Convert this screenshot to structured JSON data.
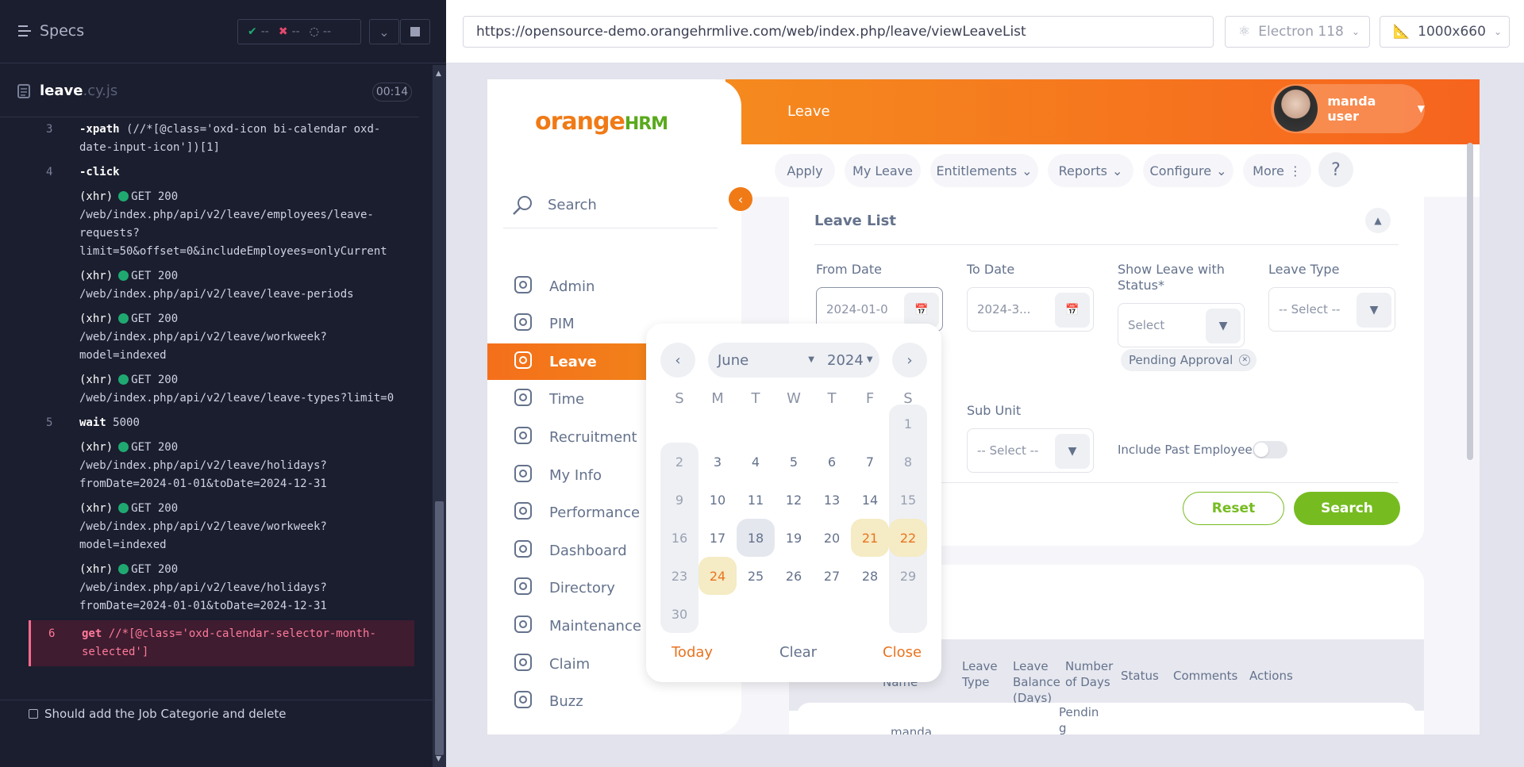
{
  "cypress": {
    "specs_label": "Specs",
    "stats": {
      "passed": "--",
      "failed": "--",
      "pending": "--"
    },
    "file": {
      "name": "leave",
      "ext": ".cy.js"
    },
    "timer": "00:14",
    "commands": [
      {
        "num": "3",
        "name": "-xpath",
        "text": "(//*[@class='oxd-icon bi-calendar oxd-date-input-icon'])[1]"
      },
      {
        "num": "4",
        "name": "-click",
        "text": ""
      },
      {
        "num": "",
        "name": "(xhr)",
        "text": "GET 200 /web/index.php/api/v2/leave/employees/leave-requests?limit=50&offset=0&includeEmployees=onlyCurrent"
      },
      {
        "num": "",
        "name": "(xhr)",
        "text": "GET 200 /web/index.php/api/v2/leave/leave-periods"
      },
      {
        "num": "",
        "name": "(xhr)",
        "text": "GET 200 /web/index.php/api/v2/leave/workweek?model=indexed"
      },
      {
        "num": "",
        "name": "(xhr)",
        "text": "GET 200 /web/index.php/api/v2/leave/leave-types?limit=0"
      },
      {
        "num": "5",
        "name": "wait",
        "text": "5000"
      },
      {
        "num": "",
        "name": "(xhr)",
        "text": "GET 200 /web/index.php/api/v2/leave/holidays?fromDate=2024-01-01&toDate=2024-12-31"
      },
      {
        "num": "",
        "name": "(xhr)",
        "text": "GET 200 /web/index.php/api/v2/leave/workweek?model=indexed"
      },
      {
        "num": "",
        "name": "(xhr)",
        "text": "GET 200 /web/index.php/api/v2/leave/holidays?fromDate=2024-01-01&toDate=2024-12-31"
      },
      {
        "num": "6",
        "name": "get",
        "text": "//*[@class='oxd-calendar-selector-month-selected']"
      }
    ],
    "test_title": "Should add the Job Categorie and delete"
  },
  "browser": {
    "url": "https://opensource-demo.orangehrmlive.com/web/index.php/leave/viewLeaveList",
    "engine": "Electron 118",
    "viewport": "1000x660"
  },
  "app": {
    "logo": {
      "orange": "orange",
      "hrm": "HRM"
    },
    "search_label": "Search",
    "nav": [
      "Admin",
      "PIM",
      "Leave",
      "Time",
      "Recruitment",
      "My Info",
      "Performance",
      "Dashboard",
      "Directory",
      "Maintenance",
      "Claim",
      "Buzz"
    ],
    "header_title": "Leave",
    "user_name": "manda user",
    "tabs": [
      "Apply",
      "My Leave",
      "Entitlements",
      "Reports",
      "Configure",
      "More"
    ],
    "help": "?",
    "leave_list": {
      "title": "Leave List",
      "from_date_label": "From Date",
      "from_date_value": "2024-01-0",
      "to_date_label": "To Date",
      "to_date_value": "2024-3...",
      "status_label": "Show Leave with Status*",
      "status_value": "Select",
      "leave_type_label": "Leave Type",
      "leave_type_value": "-- Select --",
      "chip": "Pending Approval",
      "sub_unit_label": "Sub Unit",
      "sub_unit_value": "-- Select --",
      "past_label": "Include Past Employees",
      "reset": "Reset",
      "search": "Search"
    },
    "table_headers": [
      "ee Name",
      "Leave Type",
      "Leave Balance (Days)",
      "Number of Days",
      "Status",
      "Comments",
      "Actions"
    ],
    "row": {
      "name": "manda",
      "status": "Pendin g"
    }
  },
  "calendar": {
    "month": "June",
    "year": "2024",
    "weekdays": [
      "S",
      "M",
      "T",
      "W",
      "T",
      "F",
      "S"
    ],
    "weeks": [
      [
        "",
        "",
        "",
        "",
        "",
        "",
        "1"
      ],
      [
        "2",
        "3",
        "4",
        "5",
        "6",
        "7",
        "8"
      ],
      [
        "9",
        "10",
        "11",
        "12",
        "13",
        "14",
        "15"
      ],
      [
        "16",
        "17",
        "18",
        "19",
        "20",
        "21",
        "22"
      ],
      [
        "23",
        "24",
        "25",
        "26",
        "27",
        "28",
        "29"
      ],
      [
        "30",
        "",
        "",
        "",
        "",
        "",
        ""
      ]
    ],
    "selected": "18",
    "holidays": [
      "21",
      "22",
      "24"
    ],
    "today_label": "Today",
    "clear_label": "Clear",
    "close_label": "Close",
    "accent": "#e8741f"
  }
}
